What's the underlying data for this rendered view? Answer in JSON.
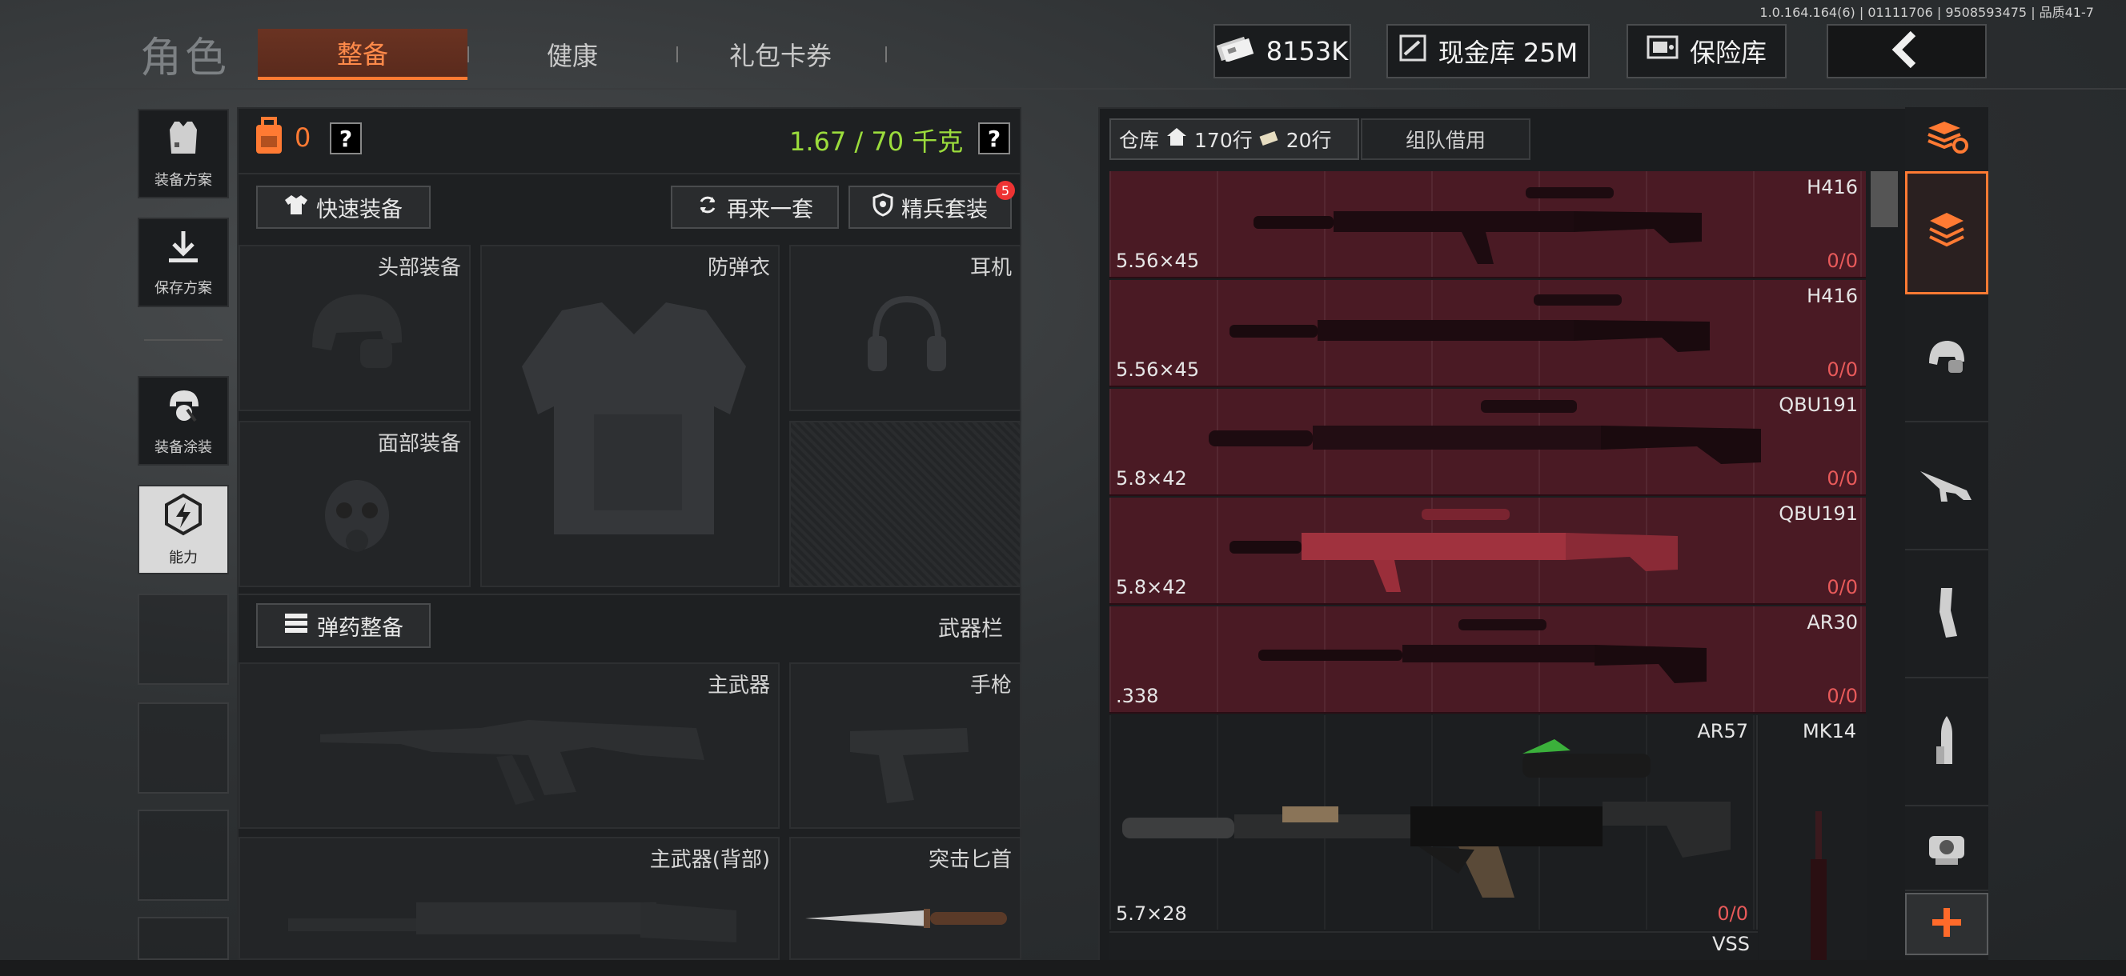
{
  "version": "1.0.164.164(6) | 01111706 | 9508593475 | 品质41-7",
  "header": {
    "role_title": "角色",
    "tabs": [
      {
        "label": "整备",
        "active": true
      },
      {
        "label": "健康",
        "active": false
      },
      {
        "label": "礼包卡券",
        "active": false
      }
    ],
    "cash": "8153K",
    "cash_vault": "现金库 25M",
    "safe_box": "保险库"
  },
  "sidebar": {
    "items": [
      {
        "label": "装备方案",
        "icon": "vest-plan-icon"
      },
      {
        "label": "保存方案",
        "icon": "download-icon"
      },
      {
        "label": "装备涂装",
        "icon": "helmet-paint-icon"
      },
      {
        "label": "能力",
        "icon": "lightning-hex-icon"
      }
    ]
  },
  "equipment": {
    "armor_count": "0",
    "weight": "1.67 / 70 千克",
    "quick_equip": "快速装备",
    "again": "再来一套",
    "elite_set": "精兵套装",
    "elite_badge": "5",
    "slots": {
      "head": "头部装备",
      "armor": "防弹衣",
      "earphone": "耳机",
      "face": "面部装备"
    },
    "ammo_btn": "弹药整备",
    "weapon_bar": "武器栏",
    "weapons": {
      "primary": "主武器",
      "pistol": "手枪",
      "primary_back": "主武器(背部)",
      "knife": "突击匕首"
    }
  },
  "warehouse": {
    "tab_label": "仓库",
    "rows_total": "170行",
    "rows_used": "20行",
    "team_borrow": "组队借用",
    "items": [
      {
        "name": "H416",
        "ammo": "5.56×45",
        "count_a": "0",
        "count_b": "0"
      },
      {
        "name": "H416",
        "ammo": "5.56×45",
        "count_a": "0",
        "count_b": "0"
      },
      {
        "name": "QBU191",
        "ammo": "5.8×42",
        "count_a": "0",
        "count_b": "0"
      },
      {
        "name": "QBU191",
        "ammo": "5.8×42",
        "count_a": "0",
        "count_b": "0"
      },
      {
        "name": "AR30",
        "ammo": ".338",
        "count_a": "0",
        "count_b": "0"
      },
      {
        "name": "AR57",
        "ammo": "5.7×28",
        "count_a": "0",
        "count_b": "0"
      }
    ],
    "mk14": "MK14",
    "vss": "VSS"
  },
  "categories": [
    "stack-refresh-icon",
    "box-stack-icon",
    "helmet-icon",
    "rifle-icon",
    "magazine-icon",
    "bullet-icon",
    "scope-icon"
  ]
}
